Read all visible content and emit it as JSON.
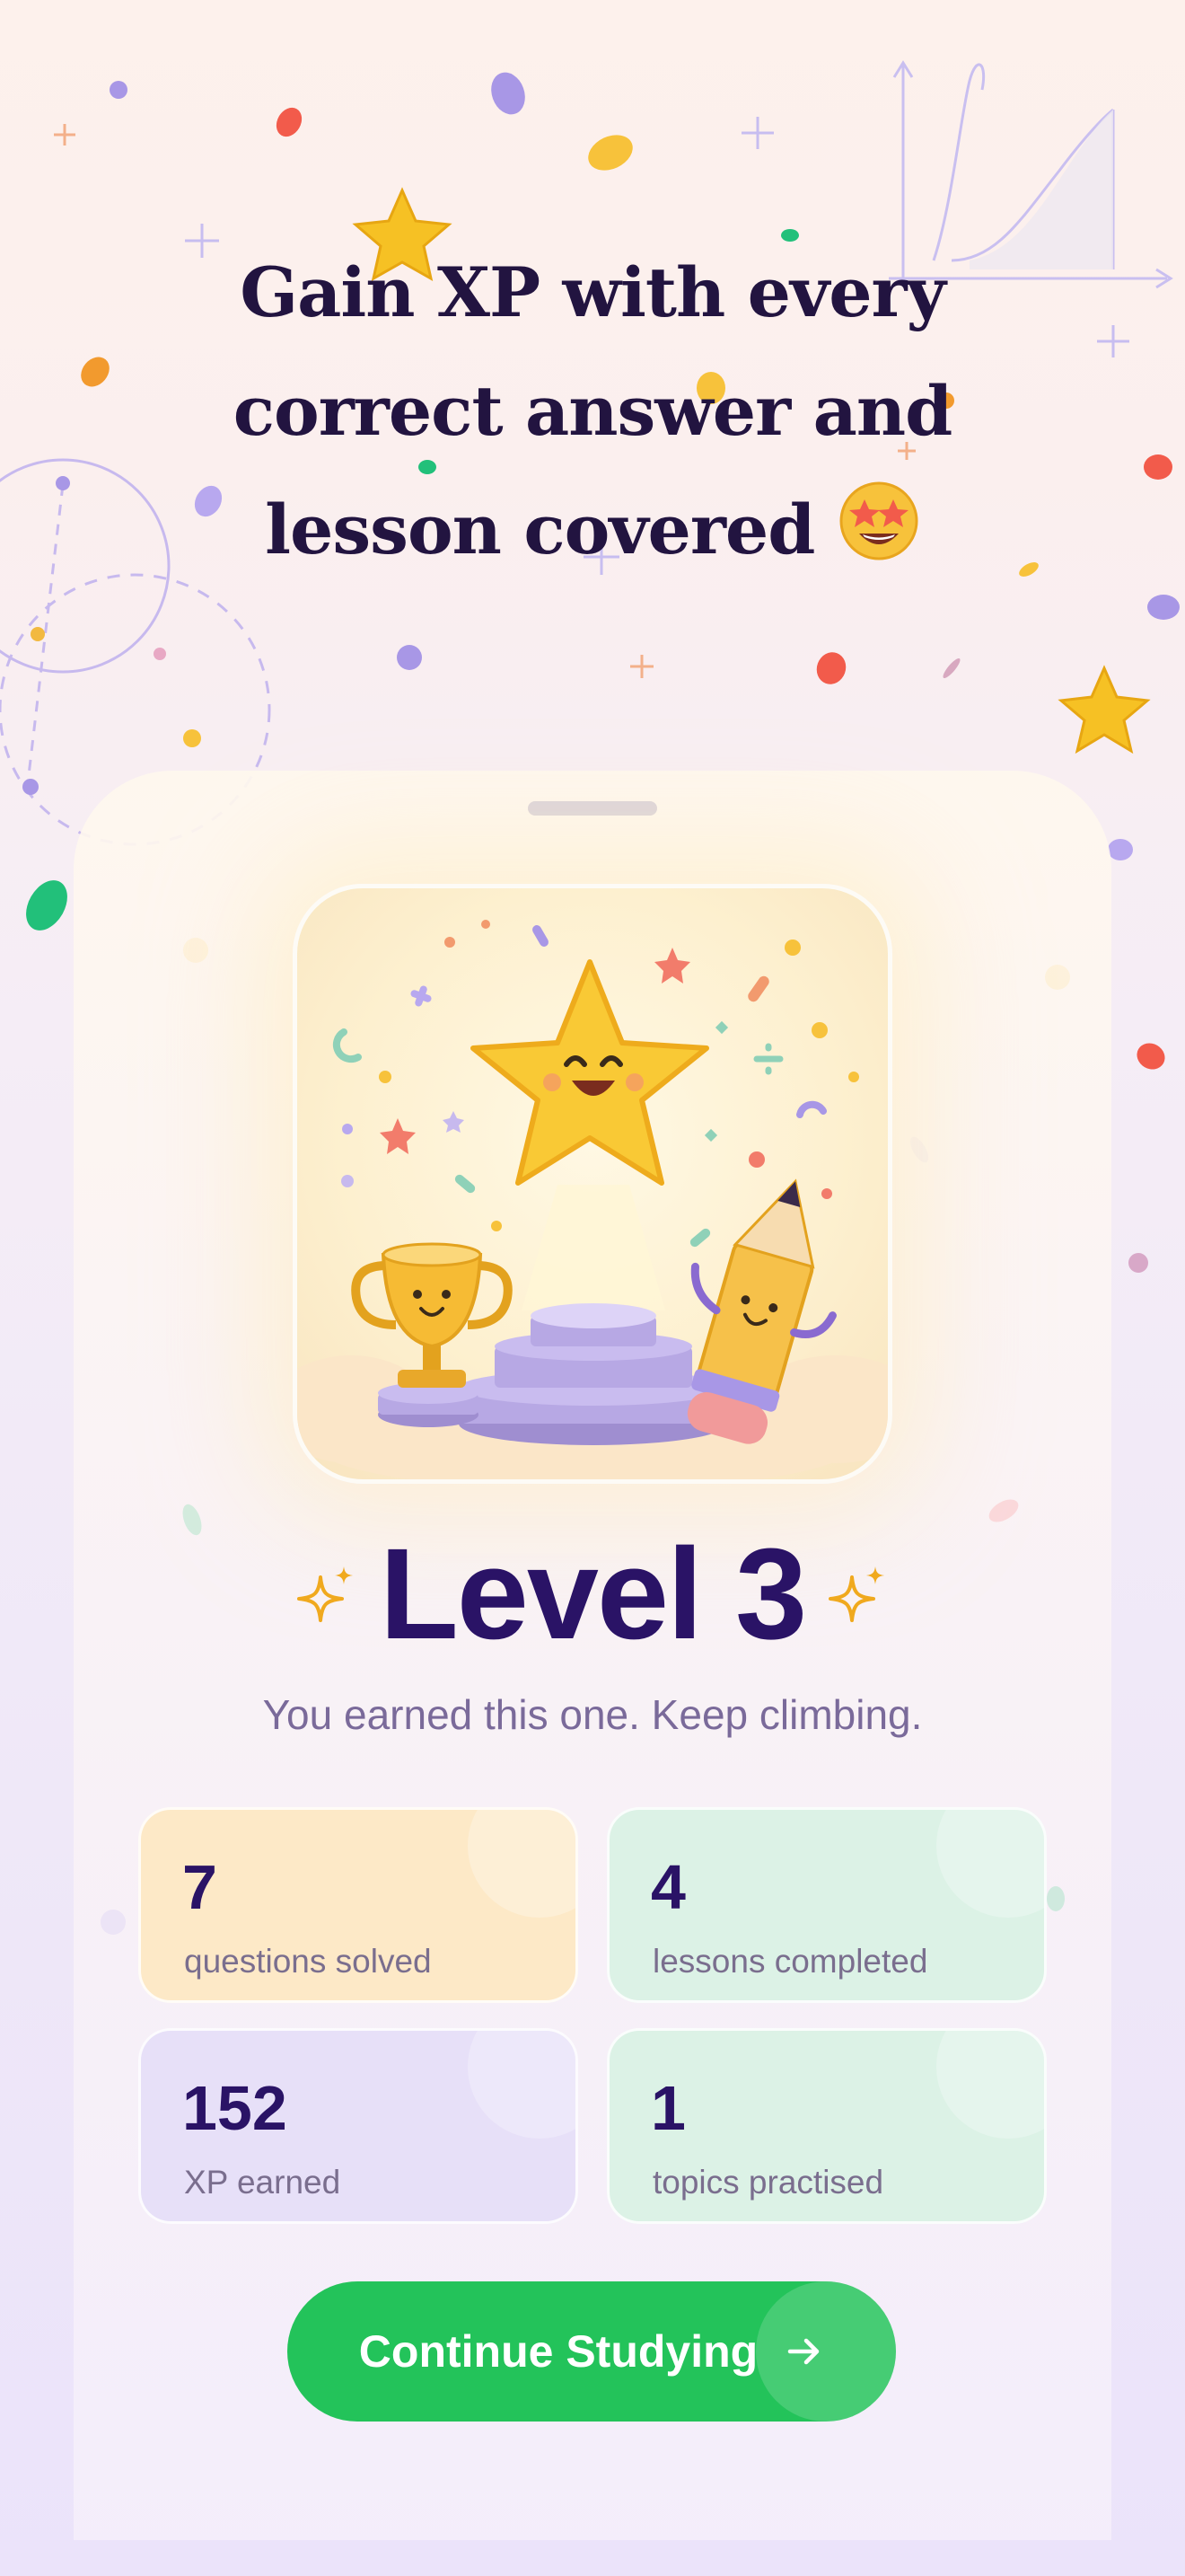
{
  "headline": {
    "line1": "Gain XP with every",
    "line2": "correct answer and",
    "line3": "lesson covered",
    "emoji": "🤩"
  },
  "decoration_icons": [
    "star-icon",
    "math-graph-icon",
    "compass-circle-icon",
    "confetti-icon"
  ],
  "hero_image": {
    "description_icon": "celebration-illustration-icon",
    "characters": [
      "star-mascot-icon",
      "trophy-mascot-icon",
      "pencil-mascot-icon",
      "podium-icon"
    ]
  },
  "level": {
    "title": "Level 3",
    "subtitle": "You earned this one. Keep climbing."
  },
  "stats": [
    {
      "value": "7",
      "label": "questions solved",
      "color": "#fde9c7"
    },
    {
      "value": "4",
      "label": "lessons completed",
      "color": "#dcf2e6"
    },
    {
      "value": "152",
      "label": "XP earned",
      "color": "#e7e0f8"
    },
    {
      "value": "1",
      "label": "topics practised",
      "color": "#dcf2e6"
    }
  ],
  "cta": {
    "label": "Continue Studying",
    "icon": "arrow-right-icon",
    "color": "#23c35a"
  },
  "colors": {
    "text_primary": "#2a1366",
    "text_secondary": "#7a6a9a",
    "accent_gold": "#f5b524"
  }
}
